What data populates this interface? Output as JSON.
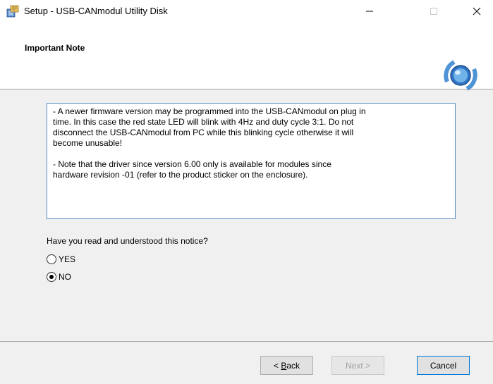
{
  "window": {
    "title": "Setup - USB-CANmodul Utility Disk",
    "controls": {
      "minimize": "—",
      "close": "✕"
    }
  },
  "header": {
    "title": "Important Note"
  },
  "notice": {
    "paragraphs": [
      "- A newer firmware version may be programmed into the USB-CANmodul on plug in\ntime. In this case the red state LED will blink with 4Hz and duty cycle 3:1. Do not\ndisconnect the USB-CANmodul from PC while this blinking cycle otherwise it will\nbecome unusable!",
      "- Note that the driver since version 6.00 only is available for modules since\nhardware revision -01 (refer to the product sticker on the enclosure)."
    ]
  },
  "question": "Have you read and understood this notice?",
  "options": [
    {
      "label": "YES",
      "selected": false
    },
    {
      "label": "NO",
      "selected": true
    }
  ],
  "buttons": {
    "back_prefix": "< ",
    "back_hotkey": "B",
    "back_rest": "ack",
    "next": "Next >",
    "cancel": "Cancel"
  }
}
